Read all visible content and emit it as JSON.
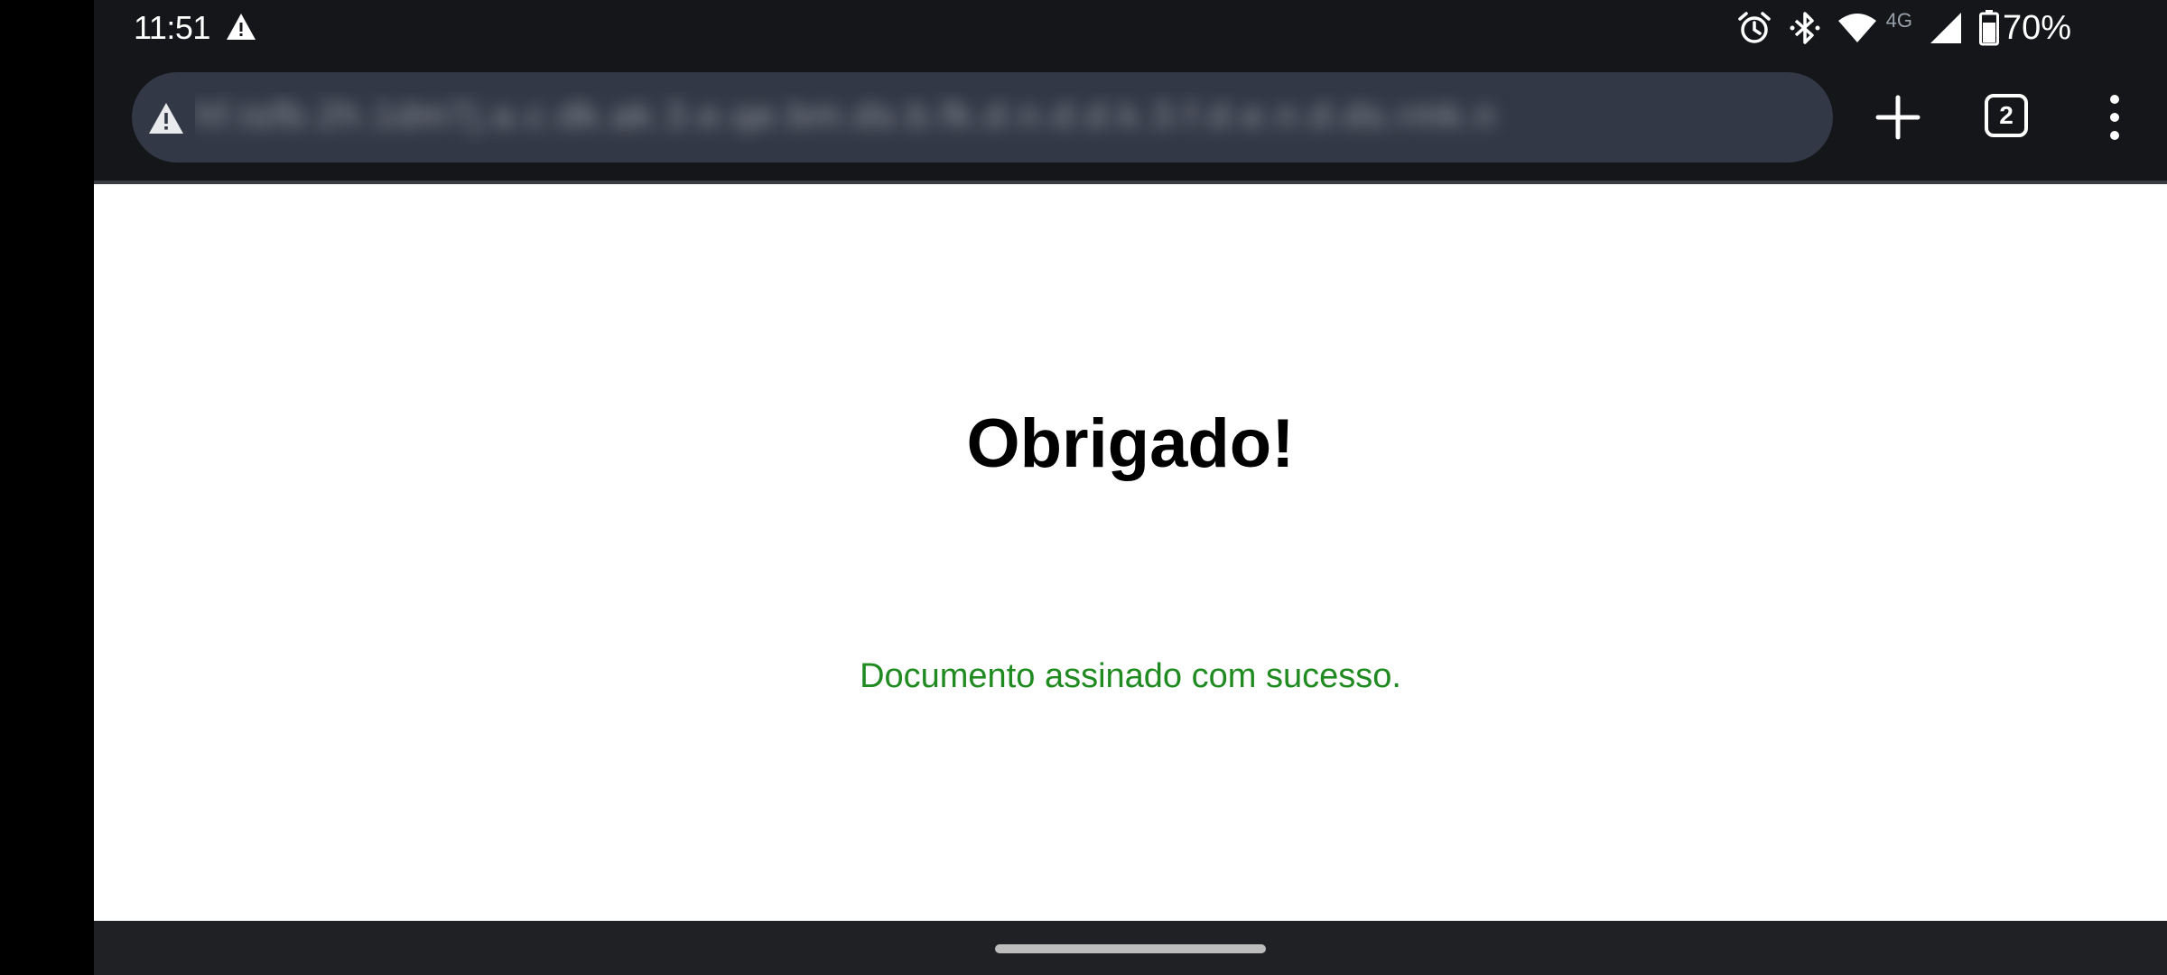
{
  "status_bar": {
    "time": "11:51",
    "network_label": "4G",
    "battery_percent": "70%",
    "icons": [
      "warning-icon",
      "alarm-icon",
      "bluetooth-icon",
      "wifi-icon",
      "signal-icon",
      "battery-icon"
    ]
  },
  "toolbar": {
    "url": "hf.tsfb.2h.1dm7j.a.c.dk.ak.3.e.qe.bm.ds.b.fk.d.n.d.d.k.3.f.d.e.n.d.ds.rmk.n",
    "tab_count": "2",
    "icons": [
      "not-secure-warning-icon",
      "plus-icon",
      "tab-switcher-icon",
      "more-vert-icon"
    ]
  },
  "page": {
    "title": "Obrigado!",
    "message": "Documento assinado com sucesso."
  },
  "colors": {
    "chrome_bg": "#15161a",
    "omnibox_bg": "#323845",
    "success_green": "#1f8a1f",
    "nav_bg": "#202124"
  }
}
